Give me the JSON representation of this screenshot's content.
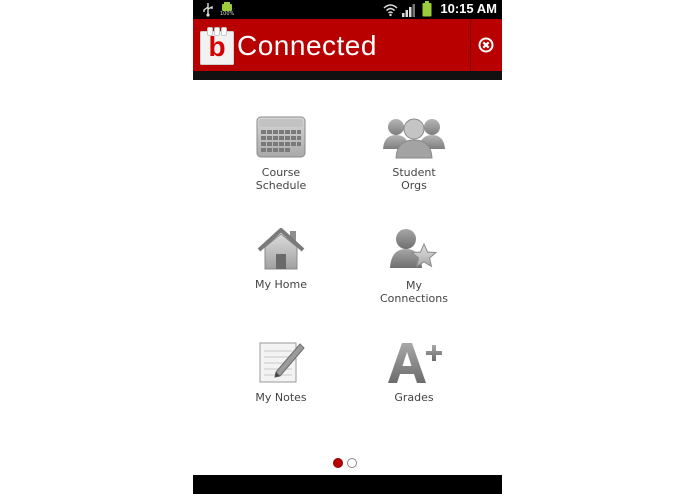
{
  "status_bar": {
    "time": "10:15 AM",
    "battery_badge": "100%",
    "icons": [
      "usb-icon",
      "android-battery-icon",
      "wifi-icon",
      "signal-icon",
      "battery-icon"
    ]
  },
  "header": {
    "logo_letter": "b",
    "title": "Connected",
    "close_icon": "close-circle-icon",
    "colors": {
      "header_red": "#b80000",
      "logo_red": "#d40000"
    }
  },
  "grid": {
    "items": [
      {
        "label_lines": [
          "Course",
          "Schedule"
        ],
        "icon": "calendar-icon"
      },
      {
        "label_lines": [
          "Student",
          "Orgs"
        ],
        "icon": "group-icon"
      },
      {
        "label_lines": [
          "My Home"
        ],
        "icon": "home-icon"
      },
      {
        "label_lines": [
          "My",
          "Connections"
        ],
        "icon": "person-star-icon"
      },
      {
        "label_lines": [
          "My Notes"
        ],
        "icon": "notepad-icon"
      },
      {
        "label_lines": [
          "Grades"
        ],
        "icon": "grade-a-plus-icon"
      }
    ]
  },
  "pager": {
    "page_count": 2,
    "current_page": 1,
    "active_color": "#b80000"
  }
}
